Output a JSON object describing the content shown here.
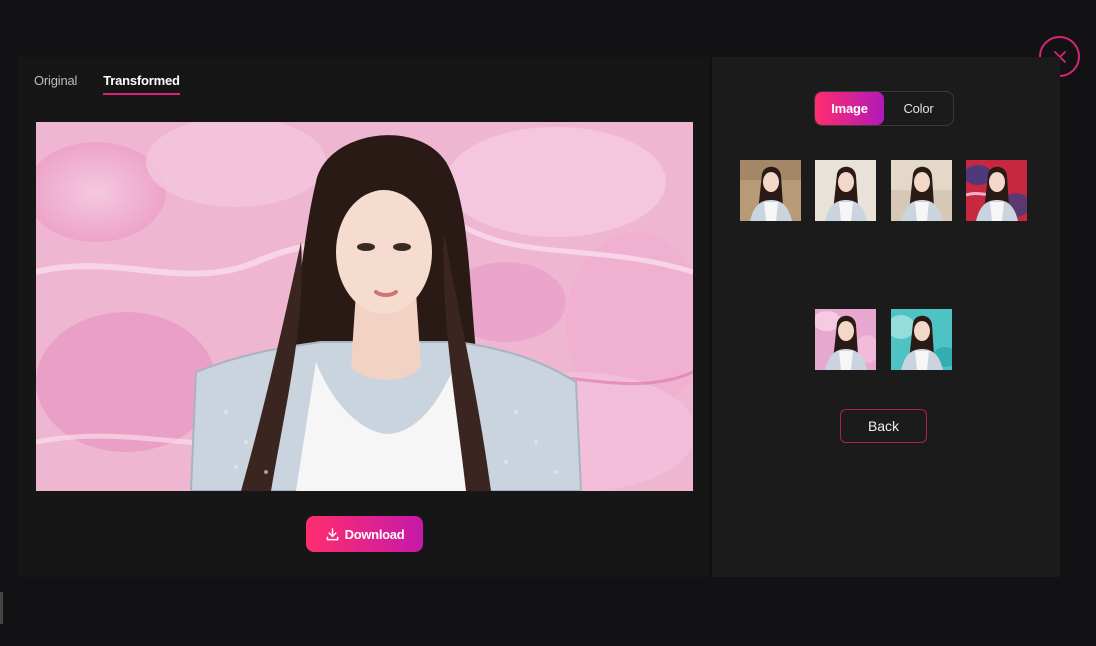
{
  "tabs": [
    {
      "label": "Original",
      "active": false
    },
    {
      "label": "Transformed",
      "active": true
    }
  ],
  "preview": {
    "background_color": "#efb6d2"
  },
  "download": {
    "label": "Download",
    "icon": "download-icon"
  },
  "mode_toggle": {
    "options": [
      {
        "label": "Image",
        "active": true
      },
      {
        "label": "Color",
        "active": false
      }
    ]
  },
  "background_thumbnails": [
    {
      "background": "#b79a76",
      "style": "brown"
    },
    {
      "background": "#e8e2d8",
      "style": "cream"
    },
    {
      "background": "#d6c8b4",
      "style": "beige"
    },
    {
      "background": "#c6293f",
      "style": "red-swirl"
    },
    {
      "background": "#e7a8cf",
      "style": "pink-marble"
    },
    {
      "background": "#4fc2c4",
      "style": "teal-marble"
    }
  ],
  "back": {
    "label": "Back"
  },
  "close": {
    "icon": "close-icon"
  },
  "colors": {
    "accent": "#d8237a",
    "gradient_start": "#ff2d6e",
    "gradient_end": "#c51aa8",
    "page_bg": "#121214",
    "panel_bg": "#161616",
    "right_panel_bg": "#1b1b1b"
  }
}
